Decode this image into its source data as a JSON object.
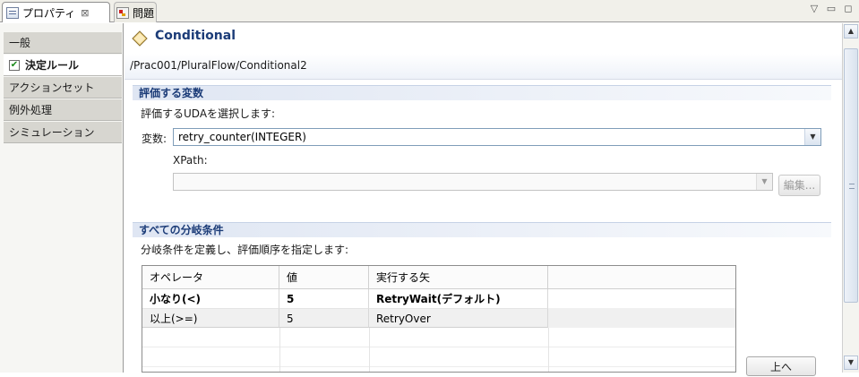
{
  "tabs": {
    "properties_label": "プロパティ",
    "problems_label": "問題"
  },
  "nav": {
    "items": [
      {
        "label": "一般"
      },
      {
        "label": "決定ルール"
      },
      {
        "label": "アクションセット"
      },
      {
        "label": "例外処理"
      },
      {
        "label": "シミュレーション"
      }
    ]
  },
  "header": {
    "title": "Conditional",
    "path": "/Prac001/PluralFlow/Conditional2"
  },
  "variables_section": {
    "title": "評価する変数",
    "description": "評価するUDAを選択します:",
    "variable_label": "変数:",
    "variable_value": "retry_counter(INTEGER)",
    "xpath_label": "XPath:",
    "xpath_value": "",
    "edit_button": "編集..."
  },
  "branches_section": {
    "title": "すべての分岐条件",
    "description": "分岐条件を定義し、評価順序を指定します:",
    "columns": [
      "オペレータ",
      "値",
      "実行する矢"
    ],
    "rows": [
      {
        "operator": "小なり(<)",
        "value": "5",
        "arrow": "RetryWait(デフォルト)",
        "bold": true
      },
      {
        "operator": "以上(>=)",
        "value": "5",
        "arrow": "RetryOver",
        "bold": false
      }
    ],
    "up_button": "上へ"
  },
  "icons": [
    "properties-view-icon",
    "close-icon",
    "problems-view-icon",
    "view-menu-icon",
    "minimize-icon",
    "maximize-icon",
    "check-icon",
    "conditional-diamond-icon",
    "dropdown-arrow-icon"
  ],
  "colors": {
    "section_title": "#1c3c78",
    "diamond_fill": "#f5d98a",
    "nav_background": "#d7d6d0"
  }
}
